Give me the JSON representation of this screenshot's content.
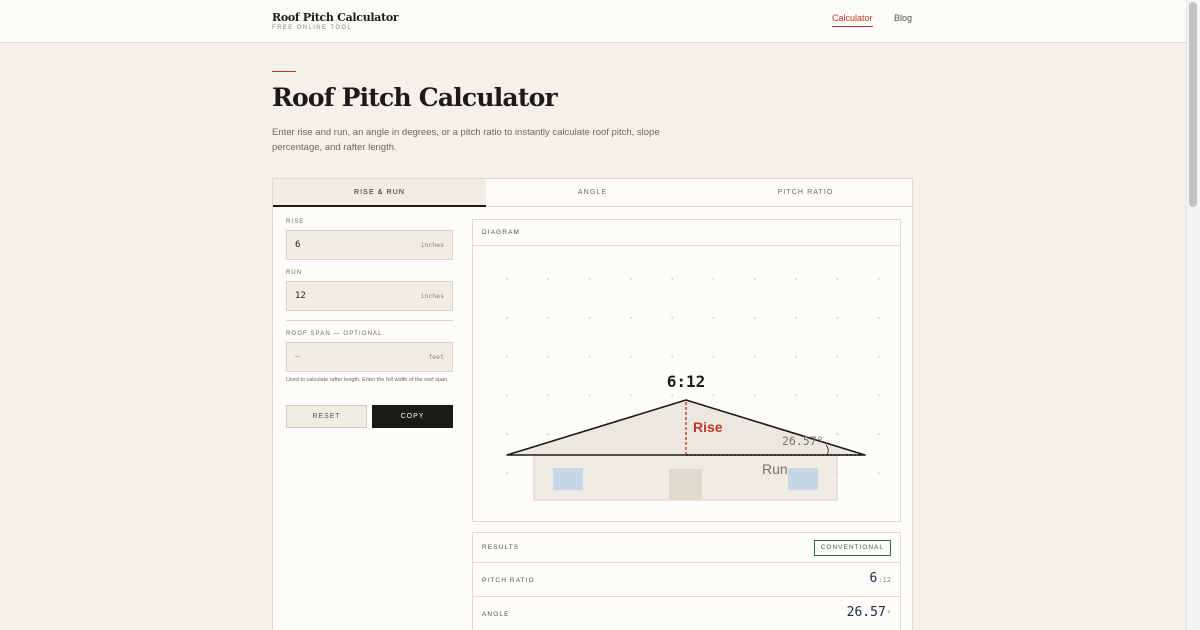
{
  "header": {
    "brand_title": "Roof Pitch Calculator",
    "brand_subtitle": "FREE ONLINE TOOL",
    "nav": [
      {
        "label": "Calculator",
        "active": true
      },
      {
        "label": "Blog",
        "active": false
      }
    ]
  },
  "hero": {
    "title": "Roof Pitch Calculator",
    "description": "Enter rise and run, an angle in degrees, or a pitch ratio to instantly calculate roof pitch, slope percentage, and rafter length."
  },
  "tabs": [
    {
      "label": "RISE & RUN",
      "active": true
    },
    {
      "label": "ANGLE",
      "active": false
    },
    {
      "label": "PITCH RATIO",
      "active": false
    }
  ],
  "inputs": {
    "rise": {
      "label": "RISE",
      "value": "6",
      "unit": "inches"
    },
    "run": {
      "label": "RUN",
      "value": "12",
      "unit": "inches"
    },
    "span": {
      "label": "ROOF SPAN — OPTIONAL",
      "placeholder": "—",
      "unit": "feet",
      "help": "Used to calculate rafter length. Enter the full width of the roof span."
    }
  },
  "buttons": {
    "reset": "RESET",
    "copy": "COPY"
  },
  "diagram": {
    "title": "DIAGRAM",
    "pitch_label": "6:12",
    "rise_label": "Rise",
    "run_label": "Run",
    "angle_label": "26.57°",
    "rise_color": "#c0392b",
    "window_color": "#c8d7e8"
  },
  "results": {
    "title": "RESULTS",
    "badge": "CONVENTIONAL",
    "rows": [
      {
        "label": "PITCH RATIO",
        "value": "6",
        "suffix": ":12"
      },
      {
        "label": "ANGLE",
        "value": "26.57",
        "suffix": "°"
      }
    ]
  },
  "colors": {
    "accent": "#b8371f",
    "ink": "#1c1a17",
    "paper": "#f4f1eb",
    "badge_green": "#2f6b4e"
  }
}
